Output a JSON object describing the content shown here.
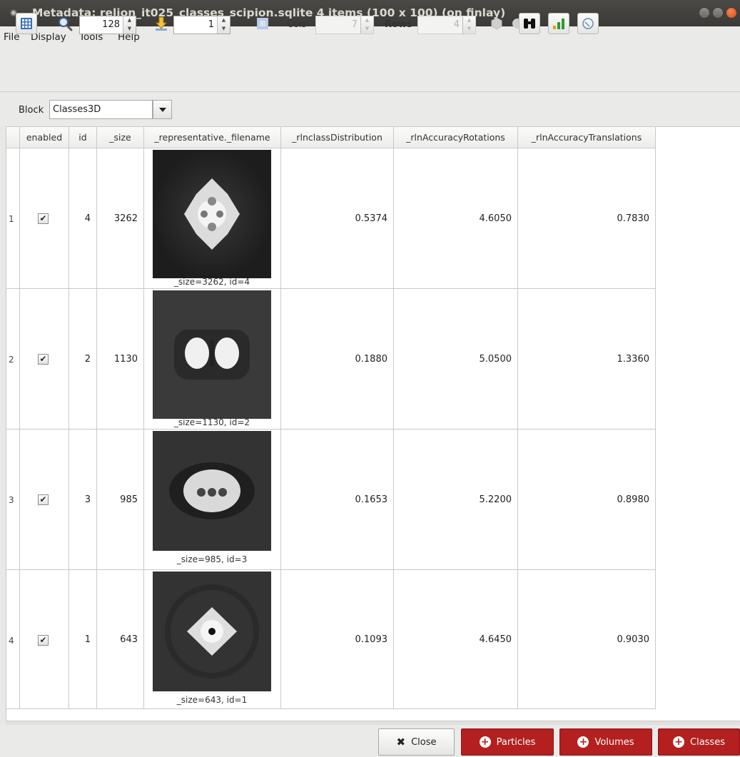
{
  "window": {
    "title": "Metadata: relion_it025_classes_scipion.sqlite 4 items (100 x 100) (on finlay)"
  },
  "menu": [
    "File",
    "Display",
    "Tools",
    "Help"
  ],
  "toolbar": {
    "zoom_value": "128",
    "goto_value": "1",
    "cols_label": "Cols",
    "cols_value": "7",
    "rows_label": "Rows",
    "rows_value": "4"
  },
  "block": {
    "label": "Block",
    "value": "Classes3D"
  },
  "table": {
    "columns": [
      "enabled",
      "id",
      "_size",
      "_representative._filename",
      "_rlnclassDistribution",
      "_rlnAccuracyRotations",
      "_rlnAccuracyTranslations"
    ],
    "rows": [
      {
        "index": "1",
        "enabled": true,
        "id": "4",
        "size": "3262",
        "caption": "_size=3262, id=4",
        "distribution": "0.5374",
        "rotations": "4.6050",
        "translations": "0.7830"
      },
      {
        "index": "2",
        "enabled": true,
        "id": "2",
        "size": "1130",
        "caption": "_size=1130, id=2",
        "distribution": "0.1880",
        "rotations": "5.0500",
        "translations": "1.3360"
      },
      {
        "index": "3",
        "enabled": true,
        "id": "3",
        "size": "985",
        "caption": "_size=985, id=3",
        "distribution": "0.1653",
        "rotations": "5.2200",
        "translations": "0.8980"
      },
      {
        "index": "4",
        "enabled": true,
        "id": "1",
        "size": "643",
        "caption": "_size=643, id=1",
        "distribution": "0.1093",
        "rotations": "4.6450",
        "translations": "0.9030"
      }
    ]
  },
  "footer": {
    "close_label": "Close",
    "particles_label": "Particles",
    "volumes_label": "Volumes",
    "classes_label": "Classes"
  },
  "colors": {
    "titlebar": "#3d3c39",
    "action_red": "#b3201f",
    "close_orange": "#e8632b"
  }
}
